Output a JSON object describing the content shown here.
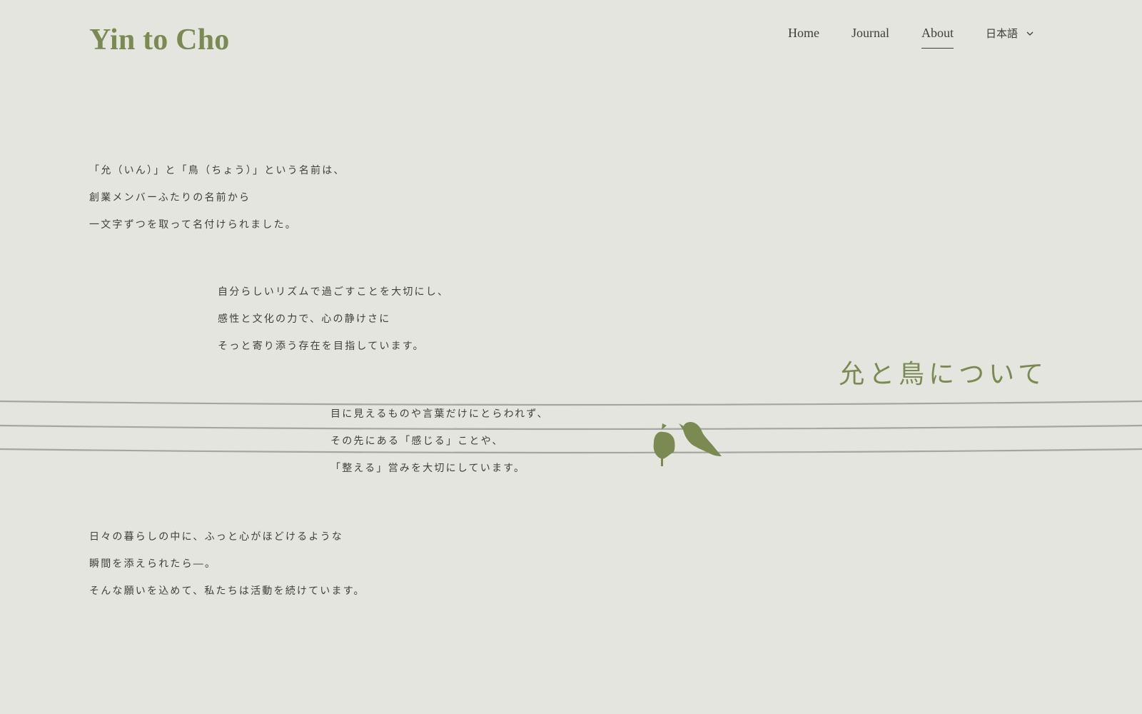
{
  "header": {
    "logo": "Yin to Cho",
    "nav": [
      {
        "label": "Home",
        "active": false
      },
      {
        "label": "Journal",
        "active": false
      },
      {
        "label": "About",
        "active": true
      }
    ],
    "language": {
      "selected": "日本語",
      "icon": "chevron-down-icon"
    }
  },
  "main": {
    "title": "允と鳥について",
    "paragraphs": [
      {
        "lines": [
          "「允（いん）」と「鳥（ちょう）」という名前は、",
          "創業メンバーふたりの名前から",
          "一文字ずつを取って名付けられました。"
        ]
      },
      {
        "lines": [
          "自分らしいリズムで過ごすことを大切にし、",
          "感性と文化の力で、心の静けさに",
          "そっと寄り添う存在を目指しています。"
        ]
      },
      {
        "lines": [
          "目に見えるものや言葉だけにとらわれず、",
          "その先にある「感じる」ことや、",
          "「整える」営みを大切にしています。"
        ]
      },
      {
        "lines": [
          "日々の暮らしの中に、ふっと心がほどけるような",
          "瞬間を添えられたら―。",
          "そんな願いを込めて、私たちは活動を続けています。"
        ]
      }
    ],
    "illustration": {
      "icon": "birds-on-wire-icon"
    }
  },
  "colors": {
    "background": "#e4e5df",
    "accent": "#7a8a50",
    "text": "#3f3f3b",
    "wire": "#a4a6a0"
  }
}
